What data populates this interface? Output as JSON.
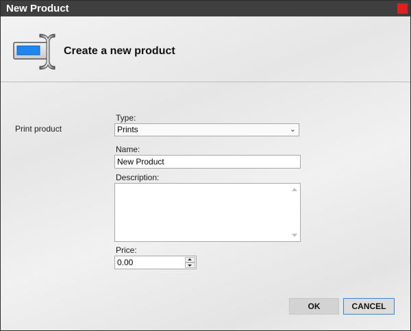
{
  "window": {
    "title": "New Product"
  },
  "header": {
    "title": "Create a new product",
    "icon": "text-field-icon"
  },
  "form": {
    "section_label": "Print product",
    "type": {
      "label": "Type:",
      "value": "Prints"
    },
    "name": {
      "label": "Name:",
      "value": "New Product"
    },
    "description": {
      "label": "Description:",
      "value": ""
    },
    "price": {
      "label": "Price:",
      "value": "0.00"
    }
  },
  "buttons": {
    "ok": "OK",
    "cancel": "CANCEL"
  },
  "colors": {
    "titlebar": "#3f3f3f",
    "close": "#e02020",
    "accent": "#3b7fd6"
  }
}
